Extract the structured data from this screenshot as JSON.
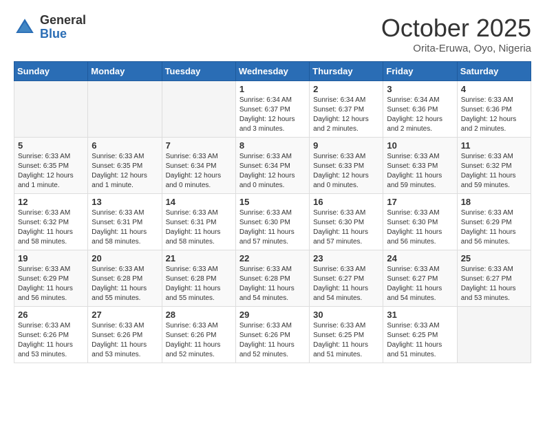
{
  "header": {
    "logo_general": "General",
    "logo_blue": "Blue",
    "month": "October 2025",
    "location": "Orita-Eruwa, Oyo, Nigeria"
  },
  "days_of_week": [
    "Sunday",
    "Monday",
    "Tuesday",
    "Wednesday",
    "Thursday",
    "Friday",
    "Saturday"
  ],
  "weeks": [
    [
      {
        "num": "",
        "info": ""
      },
      {
        "num": "",
        "info": ""
      },
      {
        "num": "",
        "info": ""
      },
      {
        "num": "1",
        "info": "Sunrise: 6:34 AM\nSunset: 6:37 PM\nDaylight: 12 hours and 3 minutes."
      },
      {
        "num": "2",
        "info": "Sunrise: 6:34 AM\nSunset: 6:37 PM\nDaylight: 12 hours and 2 minutes."
      },
      {
        "num": "3",
        "info": "Sunrise: 6:34 AM\nSunset: 6:36 PM\nDaylight: 12 hours and 2 minutes."
      },
      {
        "num": "4",
        "info": "Sunrise: 6:33 AM\nSunset: 6:36 PM\nDaylight: 12 hours and 2 minutes."
      }
    ],
    [
      {
        "num": "5",
        "info": "Sunrise: 6:33 AM\nSunset: 6:35 PM\nDaylight: 12 hours and 1 minute."
      },
      {
        "num": "6",
        "info": "Sunrise: 6:33 AM\nSunset: 6:35 PM\nDaylight: 12 hours and 1 minute."
      },
      {
        "num": "7",
        "info": "Sunrise: 6:33 AM\nSunset: 6:34 PM\nDaylight: 12 hours and 0 minutes."
      },
      {
        "num": "8",
        "info": "Sunrise: 6:33 AM\nSunset: 6:34 PM\nDaylight: 12 hours and 0 minutes."
      },
      {
        "num": "9",
        "info": "Sunrise: 6:33 AM\nSunset: 6:33 PM\nDaylight: 12 hours and 0 minutes."
      },
      {
        "num": "10",
        "info": "Sunrise: 6:33 AM\nSunset: 6:33 PM\nDaylight: 11 hours and 59 minutes."
      },
      {
        "num": "11",
        "info": "Sunrise: 6:33 AM\nSunset: 6:32 PM\nDaylight: 11 hours and 59 minutes."
      }
    ],
    [
      {
        "num": "12",
        "info": "Sunrise: 6:33 AM\nSunset: 6:32 PM\nDaylight: 11 hours and 58 minutes."
      },
      {
        "num": "13",
        "info": "Sunrise: 6:33 AM\nSunset: 6:31 PM\nDaylight: 11 hours and 58 minutes."
      },
      {
        "num": "14",
        "info": "Sunrise: 6:33 AM\nSunset: 6:31 PM\nDaylight: 11 hours and 58 minutes."
      },
      {
        "num": "15",
        "info": "Sunrise: 6:33 AM\nSunset: 6:30 PM\nDaylight: 11 hours and 57 minutes."
      },
      {
        "num": "16",
        "info": "Sunrise: 6:33 AM\nSunset: 6:30 PM\nDaylight: 11 hours and 57 minutes."
      },
      {
        "num": "17",
        "info": "Sunrise: 6:33 AM\nSunset: 6:30 PM\nDaylight: 11 hours and 56 minutes."
      },
      {
        "num": "18",
        "info": "Sunrise: 6:33 AM\nSunset: 6:29 PM\nDaylight: 11 hours and 56 minutes."
      }
    ],
    [
      {
        "num": "19",
        "info": "Sunrise: 6:33 AM\nSunset: 6:29 PM\nDaylight: 11 hours and 56 minutes."
      },
      {
        "num": "20",
        "info": "Sunrise: 6:33 AM\nSunset: 6:28 PM\nDaylight: 11 hours and 55 minutes."
      },
      {
        "num": "21",
        "info": "Sunrise: 6:33 AM\nSunset: 6:28 PM\nDaylight: 11 hours and 55 minutes."
      },
      {
        "num": "22",
        "info": "Sunrise: 6:33 AM\nSunset: 6:28 PM\nDaylight: 11 hours and 54 minutes."
      },
      {
        "num": "23",
        "info": "Sunrise: 6:33 AM\nSunset: 6:27 PM\nDaylight: 11 hours and 54 minutes."
      },
      {
        "num": "24",
        "info": "Sunrise: 6:33 AM\nSunset: 6:27 PM\nDaylight: 11 hours and 54 minutes."
      },
      {
        "num": "25",
        "info": "Sunrise: 6:33 AM\nSunset: 6:27 PM\nDaylight: 11 hours and 53 minutes."
      }
    ],
    [
      {
        "num": "26",
        "info": "Sunrise: 6:33 AM\nSunset: 6:26 PM\nDaylight: 11 hours and 53 minutes."
      },
      {
        "num": "27",
        "info": "Sunrise: 6:33 AM\nSunset: 6:26 PM\nDaylight: 11 hours and 53 minutes."
      },
      {
        "num": "28",
        "info": "Sunrise: 6:33 AM\nSunset: 6:26 PM\nDaylight: 11 hours and 52 minutes."
      },
      {
        "num": "29",
        "info": "Sunrise: 6:33 AM\nSunset: 6:26 PM\nDaylight: 11 hours and 52 minutes."
      },
      {
        "num": "30",
        "info": "Sunrise: 6:33 AM\nSunset: 6:25 PM\nDaylight: 11 hours and 51 minutes."
      },
      {
        "num": "31",
        "info": "Sunrise: 6:33 AM\nSunset: 6:25 PM\nDaylight: 11 hours and 51 minutes."
      },
      {
        "num": "",
        "info": ""
      }
    ]
  ]
}
